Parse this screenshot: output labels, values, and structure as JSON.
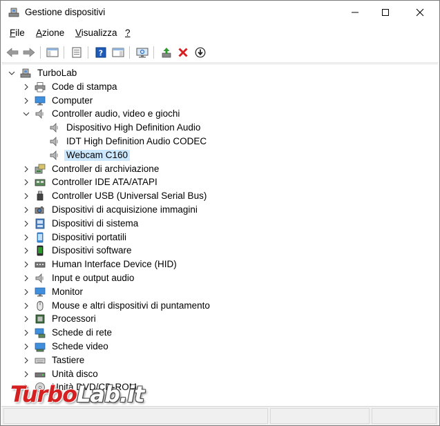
{
  "window": {
    "title": "Gestione dispositivi"
  },
  "menu": [
    {
      "first": "F",
      "rest": "ile"
    },
    {
      "first": "A",
      "rest": "zione"
    },
    {
      "first": "V",
      "rest": "isualizza"
    },
    {
      "first": "?",
      "rest": ""
    }
  ],
  "tree": {
    "root": "TurboLab",
    "items": [
      "Code di stampa",
      "Computer",
      "Controller audio, video e giochi",
      "Dispositivo High Definition Audio",
      "IDT High Definition Audio CODEC",
      "Webcam C160",
      "Controller di archiviazione",
      "Controller IDE ATA/ATAPI",
      "Controller USB (Universal Serial Bus)",
      "Dispositivi di acquisizione immagini",
      "Dispositivi di sistema",
      "Dispositivi portatili",
      "Dispositivi software",
      "Human Interface Device (HID)",
      "Input e output audio",
      "Monitor",
      "Mouse e altri dispositivi di puntamento",
      "Processori",
      "Schede di rete",
      "Schede video",
      "Tastiere",
      "Unità disco",
      "Unità DVD/CD-ROM"
    ]
  },
  "watermark": {
    "part1": "Turbo",
    "part2": "Lab.it"
  },
  "colors": {
    "selection": "#cce8ff",
    "remove_red": "#d42020",
    "enable_green": "#2e9b2e",
    "watermark_red": "#d42020"
  }
}
